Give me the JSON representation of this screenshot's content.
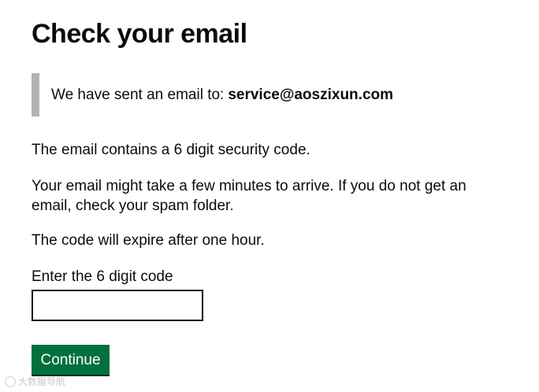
{
  "heading": "Check your email",
  "notice": {
    "prefix": "We have sent an email to:",
    "email": "service@aoszixun.com"
  },
  "paragraphs": [
    "The email contains a 6 digit security code.",
    "Your email might take a few minutes to arrive. If you do not get an email, check your spam folder.",
    "The code will expire after one hour."
  ],
  "code_field": {
    "label": "Enter the 6 digit code",
    "value": "",
    "placeholder": ""
  },
  "continue_button": {
    "label": "Continue"
  },
  "colors": {
    "button": "#00703c",
    "inset_border": "#b1b4b6",
    "text": "#0b0c0c"
  },
  "watermark": {
    "text": "大数据导航"
  }
}
